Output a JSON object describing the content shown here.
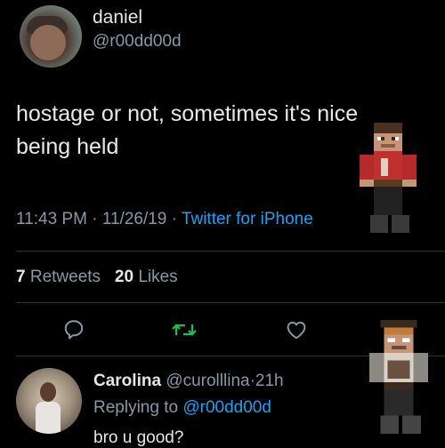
{
  "author": {
    "name": "daniel",
    "handle": "@r00dd00d"
  },
  "tweet": {
    "text_line1": "hostage or not, sometimes it's nice",
    "text_line2": "being held",
    "time": "11:43 PM",
    "date": "11/26/19",
    "separator": "·",
    "source": "Twitter for iPhone"
  },
  "stats": {
    "retweets_count": "7",
    "retweets_label": "Retweets",
    "likes_count": "20",
    "likes_label": "Likes"
  },
  "actions": {
    "reply_icon": "comment-icon",
    "retweet_icon": "retweet-icon",
    "like_icon": "heart-icon",
    "retweet_color": "#17bf63"
  },
  "reply": {
    "name": "Carolina",
    "handle": "@curolllina",
    "age": "21h",
    "replying_to_label": "Replying to",
    "replying_to_handle": "@r00dd00d",
    "text": "bro u good?"
  },
  "colors": {
    "background": "#000000",
    "link": "#1da1f2",
    "muted": "#8899a6"
  }
}
